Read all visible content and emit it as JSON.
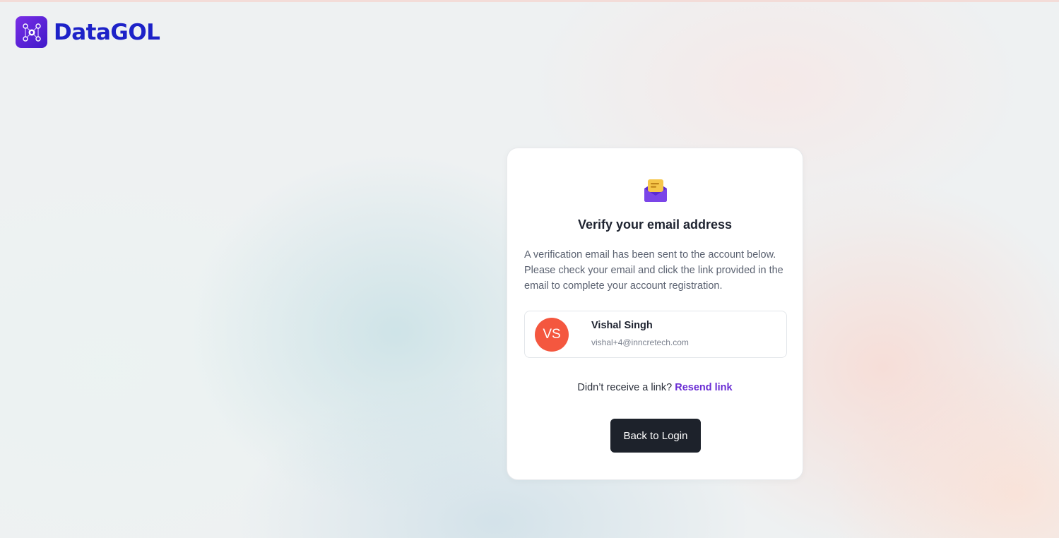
{
  "brand": {
    "name": "DataGOL",
    "icon": "network-nodes-icon",
    "colors": {
      "icon_bg": "#5a22d9",
      "text": "#1d22c8"
    }
  },
  "card": {
    "icon": "open-envelope-icon",
    "title": "Verify your email address",
    "description": "A verification email has been sent to the account below. Please check your email and click the link provided in the email to complete your account registration.",
    "user": {
      "initials": "VS",
      "name": "Vishal Singh",
      "email": "vishal+4@inncretech.com",
      "avatar_color": "#f4573f"
    },
    "resend": {
      "prompt": "Didn’t receive a link?",
      "link_label": "Resend link",
      "link_color": "#6a2dd4"
    },
    "back_button_label": "Back to Login"
  }
}
